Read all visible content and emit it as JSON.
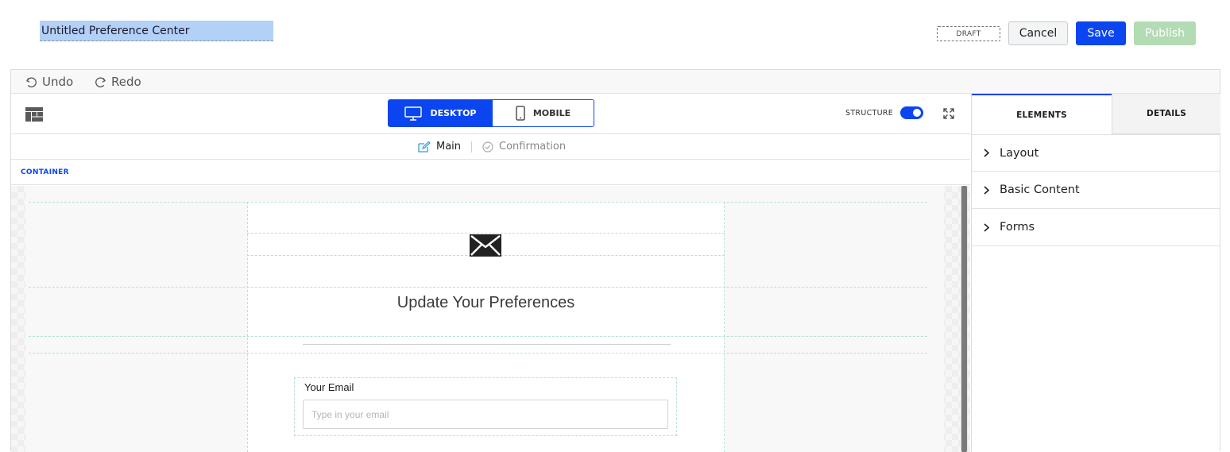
{
  "header": {
    "title_value": "Untitled Preference Center",
    "draft_badge": "DRAFT",
    "cancel_label": "Cancel",
    "save_label": "Save",
    "publish_label": "Publish"
  },
  "history": {
    "undo_label": "Undo",
    "redo_label": "Redo"
  },
  "toolbar": {
    "desktop_label": "DESKTOP",
    "mobile_label": "MOBILE",
    "structure_label": "STRUCTURE",
    "structure_on": true
  },
  "page_tabs": {
    "main_label": "Main",
    "confirmation_label": "Confirmation"
  },
  "breadcrumb": {
    "label": "CONTAINER"
  },
  "canvas": {
    "heading": "Update Your Preferences",
    "email_label": "Your Email",
    "email_placeholder": "Type in your email"
  },
  "side_panel": {
    "tabs": {
      "elements_label": "ELEMENTS",
      "details_label": "DETAILS"
    },
    "sections": [
      {
        "label": "Layout"
      },
      {
        "label": "Basic Content"
      },
      {
        "label": "Forms"
      }
    ]
  },
  "colors": {
    "accent": "#0a45f0",
    "publish_disabled": "#b3dbb4",
    "title_highlight": "#b3d0f7",
    "guide_lines": "#b6e0da"
  }
}
